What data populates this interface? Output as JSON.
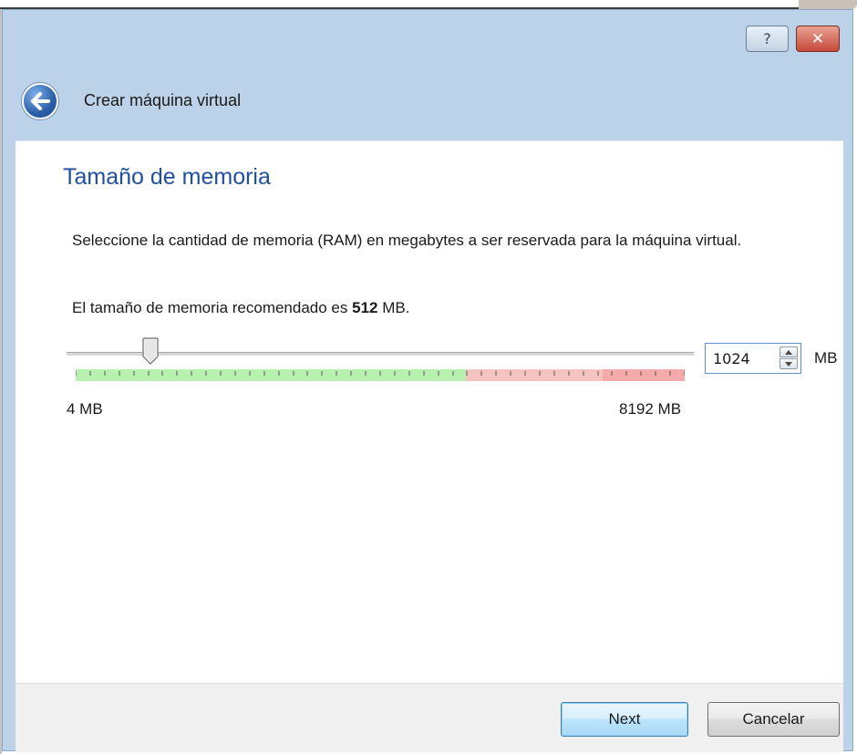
{
  "window": {
    "title": "Crear máquina virtual",
    "help_glyph": "?",
    "close_glyph": "✕"
  },
  "page": {
    "heading": "Tamaño de memoria",
    "description": "Seleccione la cantidad de memoria (RAM) en megabytes a ser reservada para la máquina virtual.",
    "recommend_prefix": "El tamaño de memoria recomendado es",
    "recommend_value": "512",
    "recommend_suffix": "MB."
  },
  "memory": {
    "min_label": "4 MB",
    "max_label": "8192 MB",
    "value": "1024",
    "unit": "MB",
    "min": 4,
    "max": 8192,
    "current": 1024
  },
  "buttons": {
    "next": "Next",
    "cancel": "Cancelar"
  },
  "colors": {
    "heading": "#1f4f9e",
    "frame": "#bcd2e8",
    "safe_zone": "#b8f0b0",
    "danger_zone": "#f6c4c0"
  }
}
